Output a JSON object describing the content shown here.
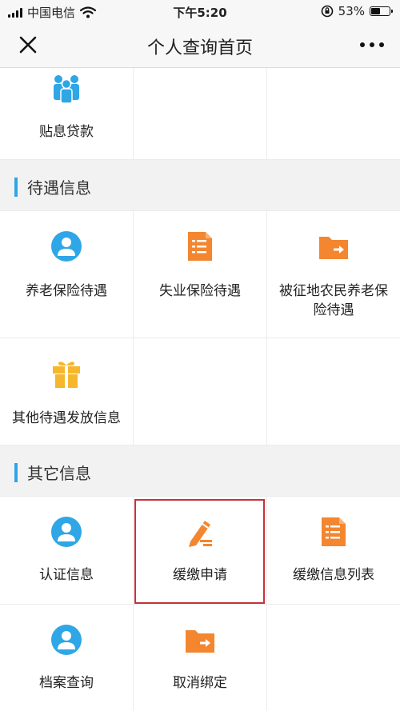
{
  "status_bar": {
    "carrier": "中国电信",
    "time": "下午5:20",
    "battery": "53%",
    "battery_level": 0.53
  },
  "nav": {
    "title": "个人查询首页"
  },
  "rows": {
    "r0": [
      "贴息贷款"
    ],
    "r1": [
      "养老保险待遇",
      "失业保险待遇",
      "被征地农民养老保\n险待遇"
    ],
    "r2": [
      "其他待遇发放信息"
    ],
    "r3": [
      "认证信息",
      "缓缴申请",
      "缓缴信息列表"
    ],
    "r4": [
      "档案查询",
      "取消绑定"
    ]
  },
  "sections": {
    "benefits": "待遇信息",
    "other": "其它信息"
  },
  "icons": {
    "loan": "people-group-icon",
    "pension": "person-icon",
    "unemployment": "document-list-icon",
    "land_pension": "folder-arrow-icon",
    "other_benefit": "gift-icon",
    "auth": "person-icon",
    "defer_apply": "pencil-edit-icon",
    "defer_list": "document-list-icon",
    "archive": "person-icon",
    "unbind": "folder-arrow-icon"
  },
  "colors": {
    "blue": "#2fa6e6",
    "orange": "#f3862f",
    "yellow": "#f6b72d",
    "highlight": "#c9313a"
  }
}
